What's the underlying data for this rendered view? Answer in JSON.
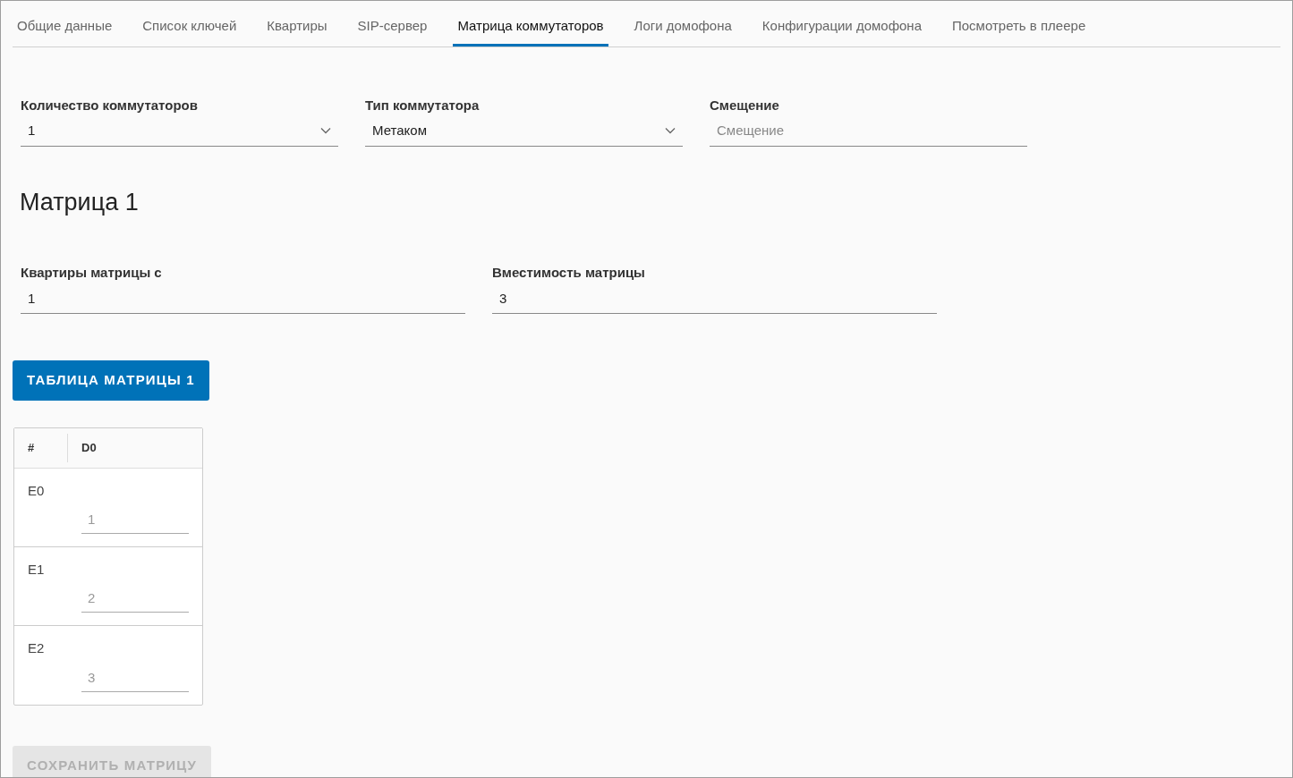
{
  "tabs": [
    {
      "label": "Общие данные",
      "selected": false
    },
    {
      "label": "Список ключей",
      "selected": false
    },
    {
      "label": "Квартиры",
      "selected": false
    },
    {
      "label": "SIP-сервер",
      "selected": false
    },
    {
      "label": "Матрица коммутаторов",
      "selected": true
    },
    {
      "label": "Логи домофона",
      "selected": false
    },
    {
      "label": "Конфигурации домофона",
      "selected": false
    },
    {
      "label": "Посмотреть в плеере",
      "selected": false
    }
  ],
  "settings": [
    {
      "kind": "select",
      "label": "Количество коммутаторов",
      "value": "1"
    },
    {
      "kind": "select",
      "label": "Тип коммутатора",
      "value": "Метаком"
    },
    {
      "kind": "input",
      "label": "Смещение",
      "placeholder": "Смещение"
    }
  ],
  "matrix": {
    "title": "Матрица 1",
    "fields": [
      {
        "label": "Квартиры матрицы с",
        "value": "1"
      },
      {
        "label": "Вместимость матрицы",
        "value": "3"
      }
    ],
    "table_button": "ТАБЛИЦА МАТРИЦЫ 1",
    "table": {
      "columns": [
        "#",
        "D0"
      ],
      "rows": [
        {
          "label": "E0",
          "cells": [
            {
              "placeholder": "1"
            }
          ]
        },
        {
          "label": "E1",
          "cells": [
            {
              "placeholder": "2"
            }
          ]
        },
        {
          "label": "E2",
          "cells": [
            {
              "placeholder": "3"
            }
          ]
        }
      ]
    },
    "save_button": {
      "label": "СОХРАНИТЬ МАТРИЦУ",
      "disabled": true
    }
  }
}
